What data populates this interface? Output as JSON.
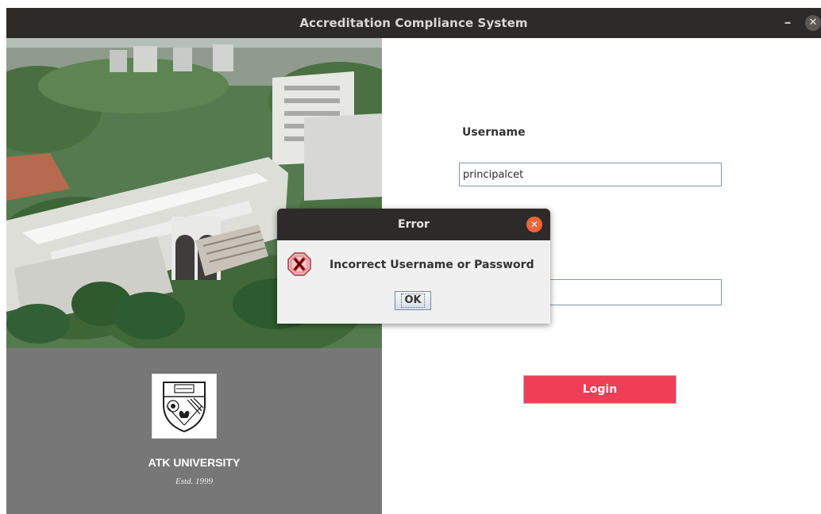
{
  "window": {
    "title": "Accreditation Compliance System",
    "minimize_glyph": "–",
    "close_glyph": "✕",
    "titlebar_color": "#2d2b2a"
  },
  "left_panel": {
    "university_name": "ATK UNIVERSITY",
    "established": "Estd. 1999",
    "panel_color": "#777777"
  },
  "form": {
    "username_label": "Username",
    "username_value": "principalcet",
    "login_label": "Login",
    "login_color": "#ef3e56"
  },
  "dialog": {
    "title": "Error",
    "message": "Incorrect Username or Password",
    "ok_label": "OK",
    "close_glyph": "✕",
    "icon_name": "error-icon",
    "close_color": "#f0643a"
  },
  "icons": {
    "minimize": "minimize-icon",
    "close": "close-icon",
    "emblem": "university-emblem-icon"
  }
}
